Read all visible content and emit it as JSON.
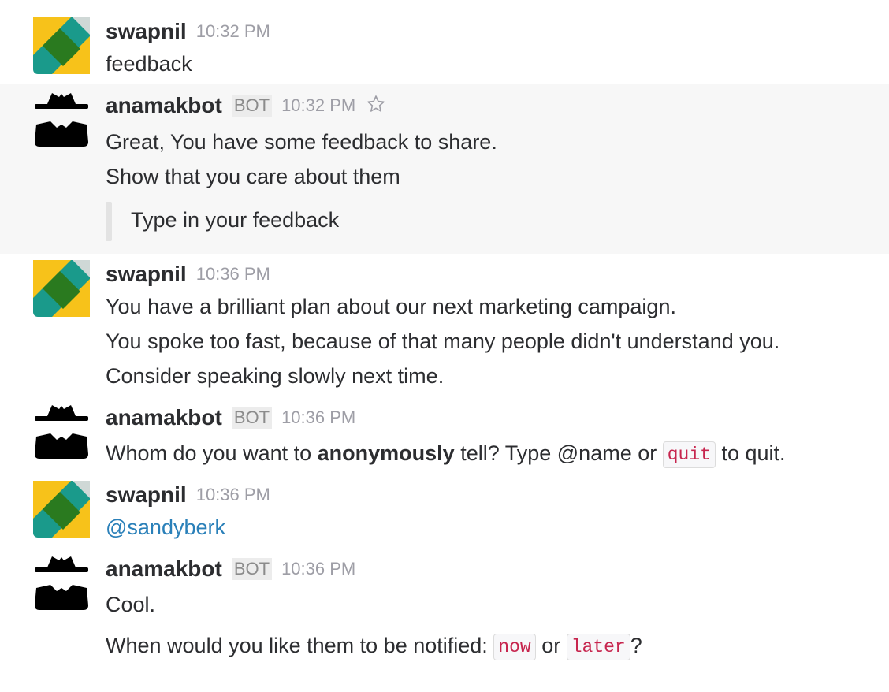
{
  "clipped_text": "... ",
  "messages": [
    {
      "author": "swapnil",
      "time": "10:32 PM",
      "lines": [
        "feedback"
      ]
    },
    {
      "author": "anamakbot",
      "bot_tag": "BOT",
      "time": "10:32 PM",
      "star_icon": "star-outline-icon",
      "lines": [
        "Great, You have some feedback to share.",
        "Show that you care about them"
      ],
      "attachment": "Type in your feedback"
    },
    {
      "author": "swapnil",
      "time": "10:36 PM",
      "lines": [
        "You have a brilliant plan about our next marketing campaign.",
        "You spoke too fast, because of that many people didn't understand you.",
        "Consider speaking slowly next time."
      ]
    },
    {
      "author": "anamakbot",
      "bot_tag": "BOT",
      "time": "10:36 PM",
      "line": {
        "pre": "Whom do you want to ",
        "bold": "anonymously",
        "mid": " tell? Type @name or ",
        "code": "quit",
        "post": " to quit."
      }
    },
    {
      "author": "swapnil",
      "time": "10:36 PM",
      "mention": "@sandyberk"
    },
    {
      "author": "anamakbot",
      "bot_tag": "BOT",
      "time": "10:36 PM",
      "line1": "Cool.",
      "line2": {
        "pre": "When would you like them to be notified: ",
        "code1": "now",
        "mid": " or ",
        "code2": "later",
        "post": "?"
      }
    }
  ],
  "colors": {
    "hover_bg": "#f7f7f7",
    "mention": "#2a80b9",
    "code": "#c7254e"
  }
}
